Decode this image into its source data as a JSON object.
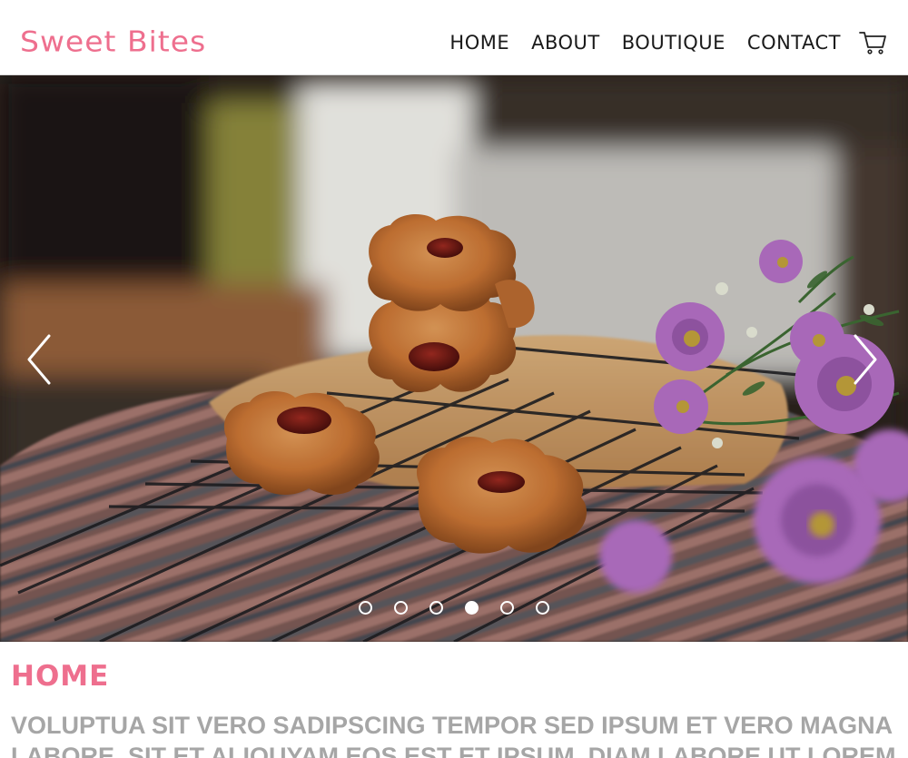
{
  "brand": {
    "name": "Sweet Bites",
    "accent_color": "#ee6f8e"
  },
  "nav": {
    "items": [
      {
        "label": "Home"
      },
      {
        "label": "About"
      },
      {
        "label": "Boutique"
      },
      {
        "label": "Contact"
      }
    ],
    "cart_icon": "shopping-cart-icon"
  },
  "carousel": {
    "prev_icon": "chevron-left-icon",
    "next_icon": "chevron-right-icon",
    "slide_count": 6,
    "active_index": 3,
    "current_image": "jam-filled pastries on cooling rack with purple flowers"
  },
  "main": {
    "title": "Home",
    "text": "Voluptua sit vero sadipscing tempor sed ipsum et vero magna labore. Sit et aliquyam eos est et ipsum. Diam labore ut lorem"
  }
}
